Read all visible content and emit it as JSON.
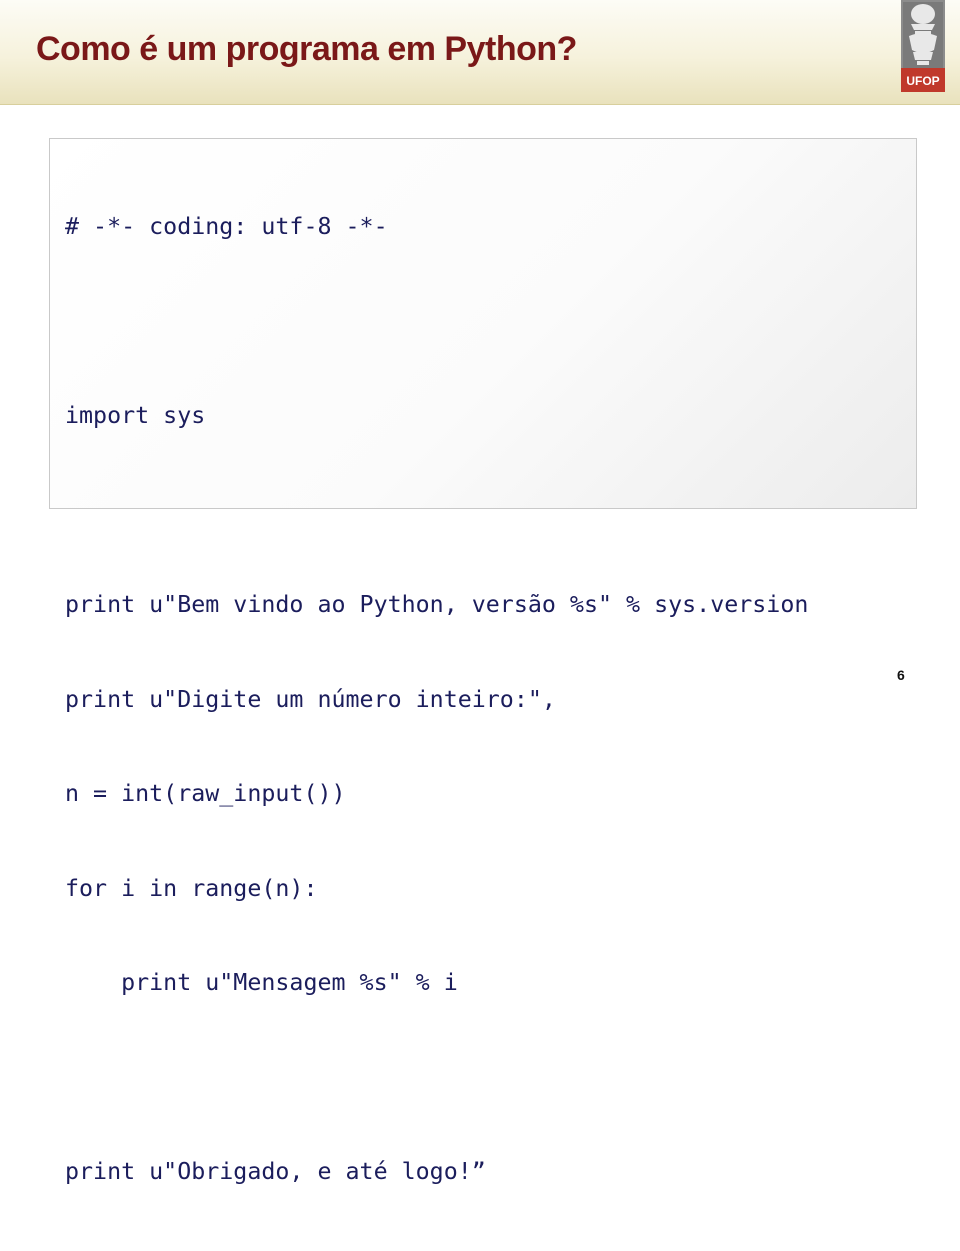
{
  "slide": {
    "title": "Como é um programa em Python?",
    "page_number": "6"
  },
  "logo": {
    "text": "UFOP",
    "icon": "ufop-crest-icon",
    "colors": {
      "crest": "#6e6e6e",
      "banner": "#c0392b"
    }
  },
  "code": {
    "lines": [
      "# -*- coding: utf-8 -*-",
      "",
      "import sys",
      "",
      "print u\"Bem vindo ao Python, versão %s\" % sys.version",
      "print u\"Digite um número inteiro:\",",
      "n = int(raw_input())",
      "for i in range(n):",
      "    print u\"Mensagem %s\" % i",
      "",
      "print u\"Obrigado, e até logo!”"
    ]
  },
  "colors": {
    "title": "#7a1818",
    "code_text": "#1b1d5c",
    "header_band": "#f6f2dc"
  }
}
